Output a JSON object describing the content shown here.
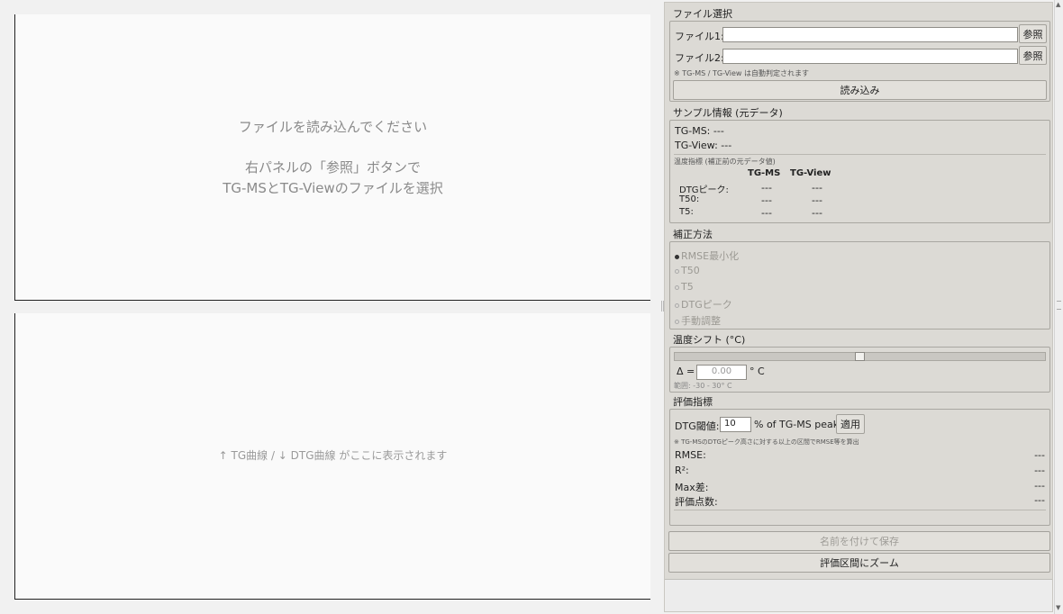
{
  "plots": {
    "placeholder_line1": "ファイルを読み込んでください",
    "placeholder_line2": "右パネルの「参照」ボタンで",
    "placeholder_line3": "TG-MSとTG-Viewのファイルを選択",
    "bottom_placeholder": "↑ TG曲線 / ↓ DTG曲線 がここに表示されます"
  },
  "file_select": {
    "title": "ファイル選択",
    "file1_label": "ファイル1:",
    "file1_value": "",
    "file2_label": "ファイル2:",
    "file2_value": "",
    "browse_label": "参照",
    "note": "※ TG-MS / TG-View は自動判定されます",
    "load_label": "読み込み"
  },
  "sample_info": {
    "title": "サンプル情報 (元データ)",
    "tgms": "TG-MS: ---",
    "tgview": "TG-View: ---",
    "temp_index_title": "温度指標 (補正前の元データ値)",
    "col_tgms": "TG-MS",
    "col_tgview": "TG-View",
    "rows": [
      {
        "label": "DTGピーク:",
        "tgms": "---",
        "tgview": "---"
      },
      {
        "label": "T50:",
        "tgms": "---",
        "tgview": "---"
      },
      {
        "label": "T5:",
        "tgms": "---",
        "tgview": "---"
      }
    ]
  },
  "correction": {
    "title": "補正方法",
    "options": [
      "RMSE最小化",
      "T50",
      "T5",
      "DTGピーク",
      "手動調整"
    ],
    "selected": "RMSE最小化"
  },
  "temp_shift": {
    "title": "温度シフト (°C)",
    "slider_value": 0.0,
    "slider_min": -30,
    "slider_max": 30,
    "delta_label": "Δ =",
    "delta_value": "0.00",
    "unit": "° C",
    "range_note": "範囲: -30 - 30° C"
  },
  "evaluation": {
    "title": "評価指標",
    "dtg_label": "DTG閾値:",
    "dtg_value": "10",
    "dtg_suffix": "% of TG-MS peak",
    "apply_label": "適用",
    "note": "※ TG-MSのDTGピーク高さに対する以上の区間でRMSE等を算出",
    "metrics": [
      {
        "label": "RMSE:",
        "value": "---"
      },
      {
        "label": "R²:",
        "value": "---"
      },
      {
        "label": "Max差:",
        "value": "---"
      },
      {
        "label": "評価点数:",
        "value": "---"
      }
    ]
  },
  "actions": {
    "save_label": "名前を付けて保存",
    "zoom_label": "評価区間にズーム"
  },
  "colors": {
    "panel_bg": "#dcdad5",
    "plot_bg": "#fafafa"
  }
}
